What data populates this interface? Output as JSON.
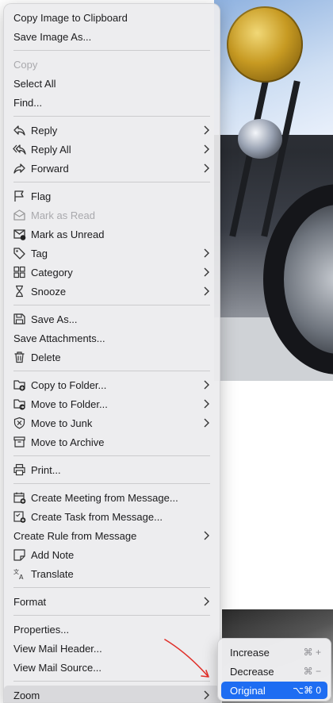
{
  "menu": {
    "items": [
      {
        "label": "Copy Image to Clipboard"
      },
      {
        "label": "Save Image As..."
      },
      {
        "label": "Copy"
      },
      {
        "label": "Select All"
      },
      {
        "label": "Find..."
      },
      {
        "label": "Reply"
      },
      {
        "label": "Reply All"
      },
      {
        "label": "Forward"
      },
      {
        "label": "Flag"
      },
      {
        "label": "Mark as Read"
      },
      {
        "label": "Mark as Unread"
      },
      {
        "label": "Tag"
      },
      {
        "label": "Category"
      },
      {
        "label": "Snooze"
      },
      {
        "label": "Save As..."
      },
      {
        "label": "Save Attachments..."
      },
      {
        "label": "Delete"
      },
      {
        "label": "Copy to Folder..."
      },
      {
        "label": "Move to Folder..."
      },
      {
        "label": "Move to Junk"
      },
      {
        "label": "Move to Archive"
      },
      {
        "label": "Print..."
      },
      {
        "label": "Create Meeting from Message..."
      },
      {
        "label": "Create Task from Message..."
      },
      {
        "label": "Create Rule from Message"
      },
      {
        "label": "Add Note"
      },
      {
        "label": "Translate"
      },
      {
        "label": "Format"
      },
      {
        "label": "Properties..."
      },
      {
        "label": "View Mail Header..."
      },
      {
        "label": "View Mail Source..."
      },
      {
        "label": "Zoom"
      }
    ]
  },
  "zoom_submenu": {
    "items": [
      {
        "label": "Increase",
        "shortcut": "⌘ +"
      },
      {
        "label": "Decrease",
        "shortcut": "⌘ −"
      },
      {
        "label": "Original",
        "shortcut": "⌥⌘ 0"
      }
    ]
  },
  "colors": {
    "selection": "#1e6df2",
    "annotation_arrow": "#e0302a"
  }
}
